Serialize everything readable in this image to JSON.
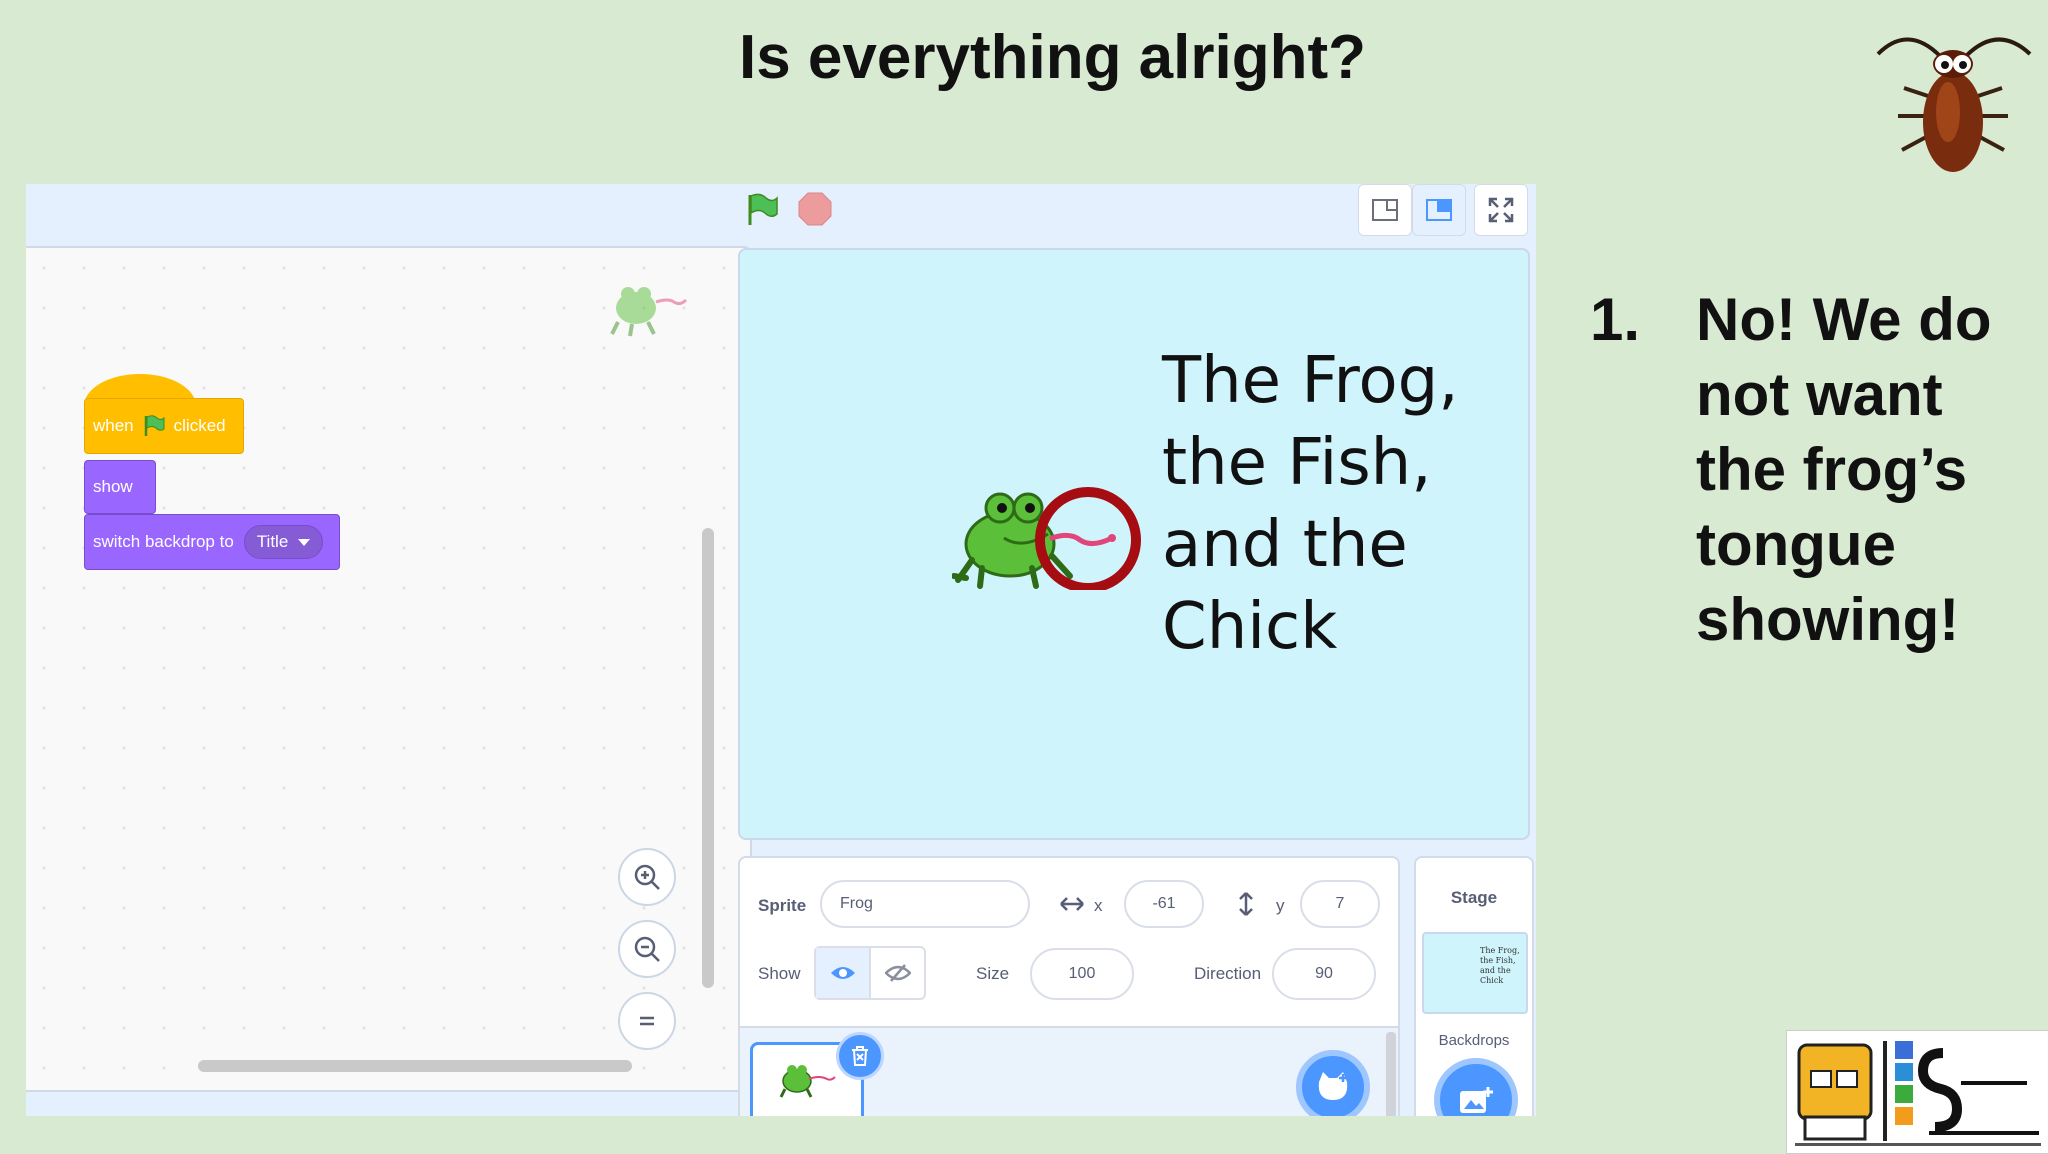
{
  "slide": {
    "title": "Is everything alright?",
    "answer_number": "1.",
    "answer_text": "No! We do not want the frog’s tongue showing!"
  },
  "editor": {
    "code_blocks": {
      "when": "when",
      "clicked": "clicked",
      "show": "show",
      "switch_backdrop": "switch backdrop to",
      "backdrop_value": "Title"
    },
    "stage_lines": [
      "The Frog,",
      "the Fish,",
      "and the",
      "Chick"
    ],
    "sprite_info": {
      "sprite_label": "Sprite",
      "sprite_name": "Frog",
      "x_label": "x",
      "x_value": "-61",
      "y_label": "y",
      "y_value": "7",
      "show_label": "Show",
      "size_label": "Size",
      "size_value": "100",
      "direction_label": "Direction",
      "direction_value": "90"
    },
    "stage_panel": {
      "label": "Stage",
      "mini_text": "The Frog, the Fish, and the Chick",
      "backdrops_label": "Backdrops"
    }
  },
  "colors": {
    "background": "#d9ead3",
    "events_block": "#ffbf00",
    "looks_block": "#9966ff",
    "scratch_blue": "#4c97ff",
    "highlight_circle": "#a50d12"
  },
  "icons": [
    "green-flag-icon",
    "stop-icon",
    "small-stage-icon",
    "normal-stage-icon",
    "fullscreen-icon",
    "zoom-in-icon",
    "zoom-out-icon",
    "zoom-reset-icon",
    "eye-icon",
    "eye-slash-icon",
    "trash-icon",
    "choose-sprite-icon",
    "choose-backdrop-icon",
    "x-arrows-icon",
    "y-arrows-icon"
  ]
}
